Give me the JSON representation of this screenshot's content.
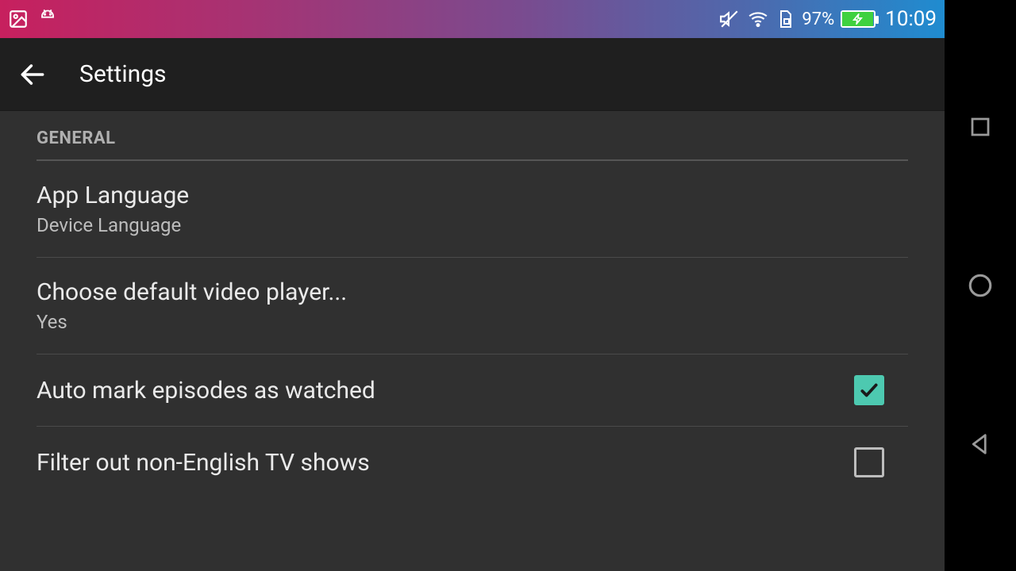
{
  "status": {
    "battery_pct": "97%",
    "time": "10:09"
  },
  "header": {
    "title": "Settings"
  },
  "section": {
    "label": "GENERAL"
  },
  "items": {
    "lang": {
      "title": "App Language",
      "subtitle": "Device Language"
    },
    "player": {
      "title": "Choose default video player...",
      "subtitle": "Yes"
    },
    "automark": {
      "title": "Auto mark episodes as watched"
    },
    "filter": {
      "title": "Filter out non-English TV shows"
    }
  }
}
